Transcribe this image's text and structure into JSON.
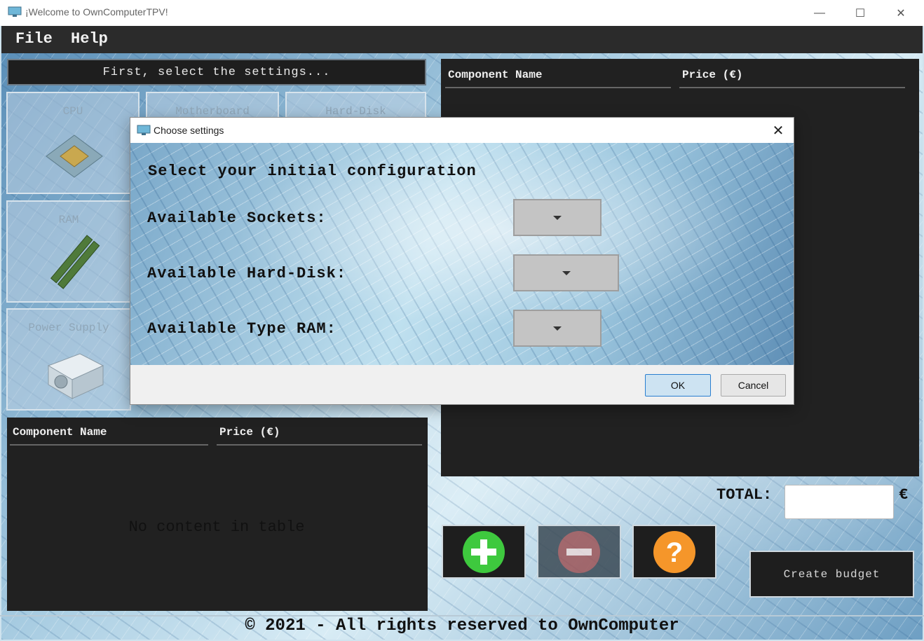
{
  "window": {
    "title": "¡Welcome to OwnComputerTPV!",
    "minimize": "—",
    "maximize": "☐",
    "close": "✕"
  },
  "menu": {
    "file": "File",
    "help": "Help"
  },
  "settings_panel": {
    "header": "First, select the settings...",
    "tiles": [
      "CPU",
      "Motherboard",
      "Hard-Disk",
      "RAM",
      "Power Supply"
    ]
  },
  "left_table": {
    "columns": [
      "Component Name",
      "Price (€)"
    ],
    "empty_text": "No content in table"
  },
  "right_table": {
    "columns": [
      "Component Name",
      "Price (€)"
    ]
  },
  "total": {
    "label": "TOTAL:",
    "value": "",
    "currency": "€"
  },
  "actions": {
    "add_icon": "plus-icon",
    "remove_icon": "minus-icon",
    "help_icon": "question-icon",
    "create_budget": "Create budget"
  },
  "footer": "© 2021 - All rights reserved to OwnComputer",
  "dialog": {
    "title": "Choose settings",
    "close": "✕",
    "heading": "Select your initial configuration",
    "fields": [
      {
        "label": "Available Sockets:",
        "value": ""
      },
      {
        "label": "Available Hard-Disk:",
        "value": ""
      },
      {
        "label": "Available Type RAM:",
        "value": ""
      }
    ],
    "ok": "OK",
    "cancel": "Cancel"
  },
  "colors": {
    "add": "#3ec93e",
    "remove": "#c85a5a",
    "help": "#f5962a",
    "dark_panel": "#212121"
  }
}
